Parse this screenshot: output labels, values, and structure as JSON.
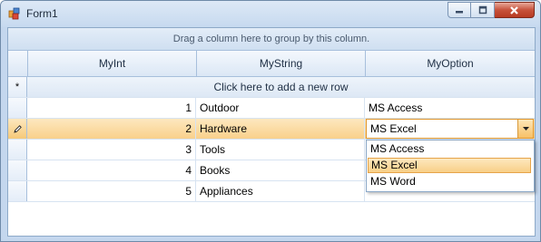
{
  "window": {
    "title": "Form1"
  },
  "grid": {
    "group_panel_text": "Drag a column here to group by this column.",
    "columns": [
      "MyInt",
      "MyString",
      "MyOption"
    ],
    "new_row_text": "Click here to add a new row",
    "new_row_marker": "*",
    "rows": [
      {
        "myint": "1",
        "mystring": "Outdoor",
        "myoption": "MS Access"
      },
      {
        "myint": "2",
        "mystring": "Hardware",
        "myoption": "MS Excel"
      },
      {
        "myint": "3",
        "mystring": "Tools",
        "myoption": ""
      },
      {
        "myint": "4",
        "mystring": "Books",
        "myoption": ""
      },
      {
        "myint": "5",
        "mystring": "Appliances",
        "myoption": ""
      }
    ],
    "editor_value": "MS Excel",
    "dropdown_options": [
      "MS Access",
      "MS Excel",
      "MS Word"
    ],
    "dropdown_selected": "MS Excel"
  },
  "icons": {
    "app": "app-icon",
    "minimize": "minimize-icon",
    "maximize": "maximize-icon",
    "close": "close-icon",
    "edit_row": "pencil-icon",
    "dropdown": "chevron-down-icon"
  },
  "colors": {
    "selection": "#f9d08b",
    "accent_border": "#e0962c",
    "grid_line": "#d7e3f1"
  }
}
